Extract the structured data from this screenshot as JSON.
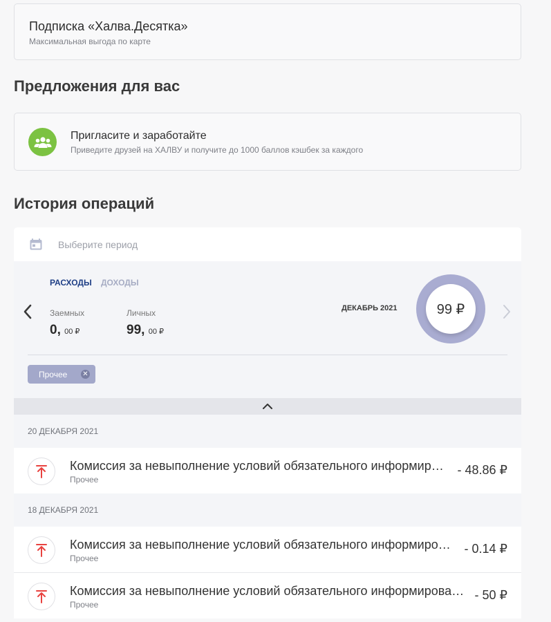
{
  "subscription": {
    "title": "Подписка «Халва.Десятка»",
    "subtitle": "Максимальная выгода по карте"
  },
  "offers": {
    "heading": "Предложения для вас",
    "item": {
      "icon": "group-icon",
      "title": "Пригласите и заработайте",
      "subtitle": "Приведите друзей на ХАЛВУ и получите до 1000 баллов кэшбек за каждого"
    }
  },
  "history": {
    "heading": "История операций",
    "period_placeholder": "Выберите период",
    "tabs": {
      "expenses": "РАСХОДЫ",
      "income": "ДОХОДЫ"
    },
    "borrowed": {
      "label": "Заемных",
      "int": "0,",
      "frac": "00 ₽"
    },
    "own": {
      "label": "Личных",
      "int": "99,",
      "frac": "00 ₽"
    },
    "month": "ДЕКАБРЬ 2021",
    "total": "99 ₽",
    "filter_chip": "Прочее",
    "groups": [
      {
        "date": "20 ДЕКАБРЯ 2021",
        "items": [
          {
            "name": "Комиссия за невыполнение условий обязательного информирования",
            "category": "Прочее",
            "amount": "- 48.86 ₽"
          }
        ]
      },
      {
        "date": "18 ДЕКАБРЯ 2021",
        "items": [
          {
            "name": "Комиссия за невыполнение условий обязательного информирования",
            "category": "Прочее",
            "amount": "- 0.14 ₽"
          },
          {
            "name": "Комиссия за невыполнение условий обязательного информирования",
            "category": "Прочее",
            "amount": "- 50 ₽"
          }
        ]
      }
    ]
  },
  "colors": {
    "accent": "#1f3f86",
    "donut": "#a9acd1",
    "chip": "#a3a8ca",
    "offer_icon_bg": "#7cc242",
    "expense_icon": "#e8423f"
  }
}
